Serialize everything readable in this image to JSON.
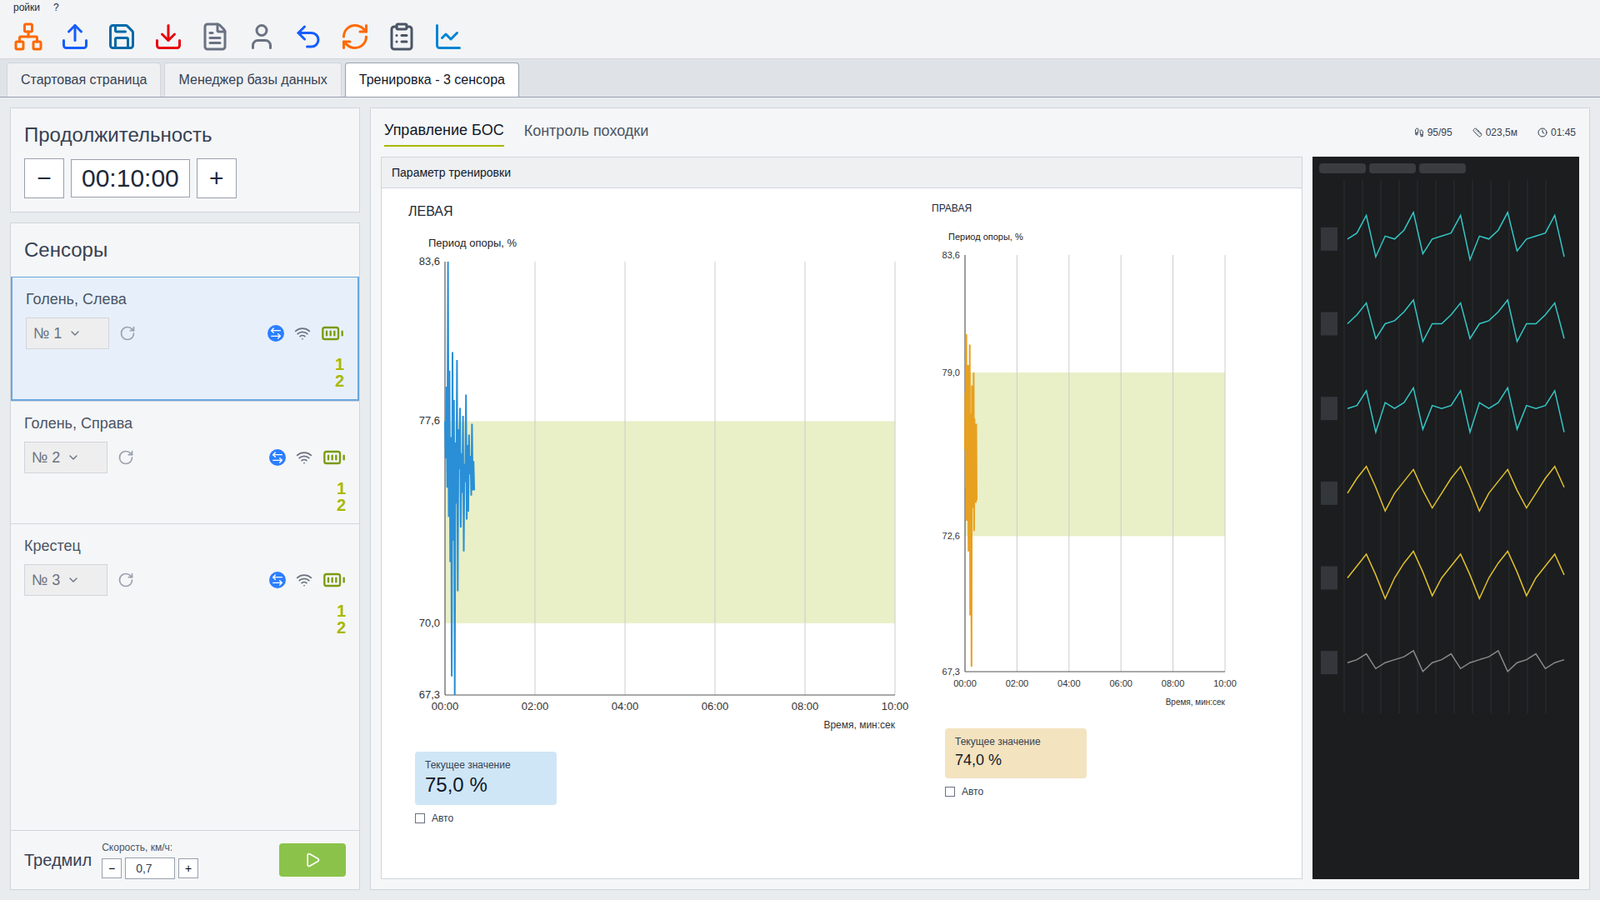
{
  "menu": {
    "items": [
      "ройки",
      "?"
    ]
  },
  "tabs": [
    {
      "label": "Стартовая страница",
      "selected": false
    },
    {
      "label": "Менеджер базы данных",
      "selected": false
    },
    {
      "label": "Тренировка - 3 сенсора",
      "selected": true
    }
  ],
  "duration": {
    "title": "Продолжительность",
    "minus": "−",
    "value": "00:10:00",
    "plus": "+"
  },
  "sensors": {
    "title": "Сенсоры",
    "items": [
      {
        "name": "Голень, Слева",
        "device": "№ 1",
        "channels": [
          "1",
          "2"
        ],
        "selected": true
      },
      {
        "name": "Голень, Справа",
        "device": "№ 2",
        "channels": [
          "1",
          "2"
        ],
        "selected": false
      },
      {
        "name": "Крестец",
        "device": "№ 3",
        "channels": [
          "1",
          "2"
        ],
        "selected": false
      }
    ]
  },
  "treadmill": {
    "title": "Тредмил",
    "speed_label": "Скорость, км/ч:",
    "speed": "0,7",
    "minus": "−",
    "plus": "+"
  },
  "subtabs": [
    {
      "label": "Управление БОС",
      "selected": true
    },
    {
      "label": "Контроль походки",
      "selected": false
    }
  ],
  "status": [
    "95/95",
    "023,5м",
    "01:45"
  ],
  "panel_title": "Параметр тренировки",
  "charts": [
    {
      "side": "ЛЕВАЯ",
      "y_title": "Период опоры, %",
      "y_ticks": [
        "83,6",
        "77,6",
        "70,0",
        "67,3"
      ],
      "y_min": 67.3,
      "y_max": 83.6,
      "band": [
        70.0,
        77.6
      ],
      "x_ticks": [
        "00:00",
        "02:00",
        "04:00",
        "06:00",
        "08:00",
        "10:00"
      ],
      "x_title": "Время, мин:сек",
      "step_seconds": 1,
      "duration_seconds": 600,
      "values": [
        77.6,
        76.2,
        78.9,
        75.1,
        83.6,
        74.0,
        79.5,
        72.3,
        77.0,
        68.0,
        80.2,
        73.1,
        78.4,
        67.3,
        76.8,
        74.5,
        79.9,
        71.2,
        77.3,
        75.8,
        78.1,
        73.6,
        76.4,
        74.9,
        77.8,
        72.7,
        76.0,
        75.3,
        78.6,
        73.9,
        76.7,
        74.2,
        77.1,
        75.6,
        76.3,
        74.8,
        77.5,
        75.0,
        76.1,
        75.0
      ],
      "color": "#2a8fd6",
      "current": {
        "label": "Текущее значение",
        "value": "75,0 %",
        "color": "#cfe6f7"
      },
      "auto": {
        "label": "Авто",
        "checked": false
      }
    },
    {
      "side": "ПРАВАЯ",
      "y_title": "Период опоры, %",
      "y_ticks": [
        "83,6",
        "79,0",
        "72,6",
        "67,3"
      ],
      "y_min": 67.3,
      "y_max": 83.6,
      "band": [
        72.6,
        79.0
      ],
      "x_ticks": [
        "00:00",
        "02:00",
        "04:00",
        "06:00",
        "08:00",
        "10:00"
      ],
      "x_title": "Время, мин:сек",
      "step_seconds": 1,
      "duration_seconds": 600,
      "values": [
        76.0,
        78.2,
        74.5,
        80.5,
        73.2,
        77.9,
        75.1,
        79.3,
        72.0,
        78.8,
        74.1,
        80.1,
        69.5,
        77.4,
        75.8,
        67.5,
        78.5,
        73.7,
        76.9,
        74.6,
        79.0,
        72.8,
        77.2,
        75.4,
        76.5,
        73.9,
        77.0,
        74.0
      ],
      "color": "#e8a020",
      "current": {
        "label": "Текущее значение",
        "value": "74,0 %",
        "color": "#f3e3bf"
      },
      "auto": {
        "label": "Авто",
        "checked": false
      }
    }
  ],
  "monitor": {
    "traces": [
      {
        "color": "#35c6c6",
        "values": [
          0,
          0.2,
          0.8,
          -0.6,
          0.1,
          0,
          0.3,
          0.9,
          -0.5,
          0,
          0.1,
          0.2,
          0.8,
          -0.7,
          0.1,
          0,
          0.3,
          0.9,
          -0.4,
          0,
          0.1,
          0.2,
          0.8,
          -0.6
        ]
      },
      {
        "color": "#35c6c6",
        "values": [
          0,
          0.3,
          0.7,
          -0.5,
          0,
          0.1,
          0.4,
          0.8,
          -0.6,
          0,
          0,
          0.3,
          0.7,
          -0.5,
          0,
          0.1,
          0.4,
          0.8,
          -0.6,
          0,
          0,
          0.3,
          0.7,
          -0.5
        ]
      },
      {
        "color": "#35c6c6",
        "values": [
          0,
          0.1,
          0.6,
          -0.8,
          0.2,
          0,
          0.2,
          0.7,
          -0.7,
          0.1,
          0,
          0.1,
          0.6,
          -0.8,
          0.2,
          0,
          0.2,
          0.7,
          -0.7,
          0.1,
          0,
          0.1,
          0.6,
          -0.8
        ]
      },
      {
        "color": "#e0c030",
        "values": [
          0,
          0.5,
          0.9,
          0.2,
          -0.6,
          0,
          0.4,
          0.8,
          0.1,
          -0.5,
          0,
          0.5,
          0.9,
          0.2,
          -0.6,
          0,
          0.4,
          0.8,
          0.1,
          -0.5,
          0,
          0.5,
          0.9,
          0.2
        ]
      },
      {
        "color": "#e0c030",
        "values": [
          0,
          0.4,
          0.8,
          0.1,
          -0.7,
          0,
          0.5,
          0.9,
          0.2,
          -0.6,
          0,
          0.4,
          0.8,
          0.1,
          -0.7,
          0,
          0.5,
          0.9,
          0.2,
          -0.6,
          0,
          0.4,
          0.8,
          0.1
        ]
      },
      {
        "color": "#8a8a8a",
        "values": [
          0,
          0.1,
          0.3,
          -0.2,
          0,
          0.1,
          0.2,
          0.4,
          -0.3,
          0,
          0.1,
          0.3,
          -0.2,
          0,
          0.1,
          0.2,
          0.4,
          -0.3,
          0,
          0.1,
          0.3,
          -0.2,
          0,
          0.1
        ]
      }
    ]
  }
}
